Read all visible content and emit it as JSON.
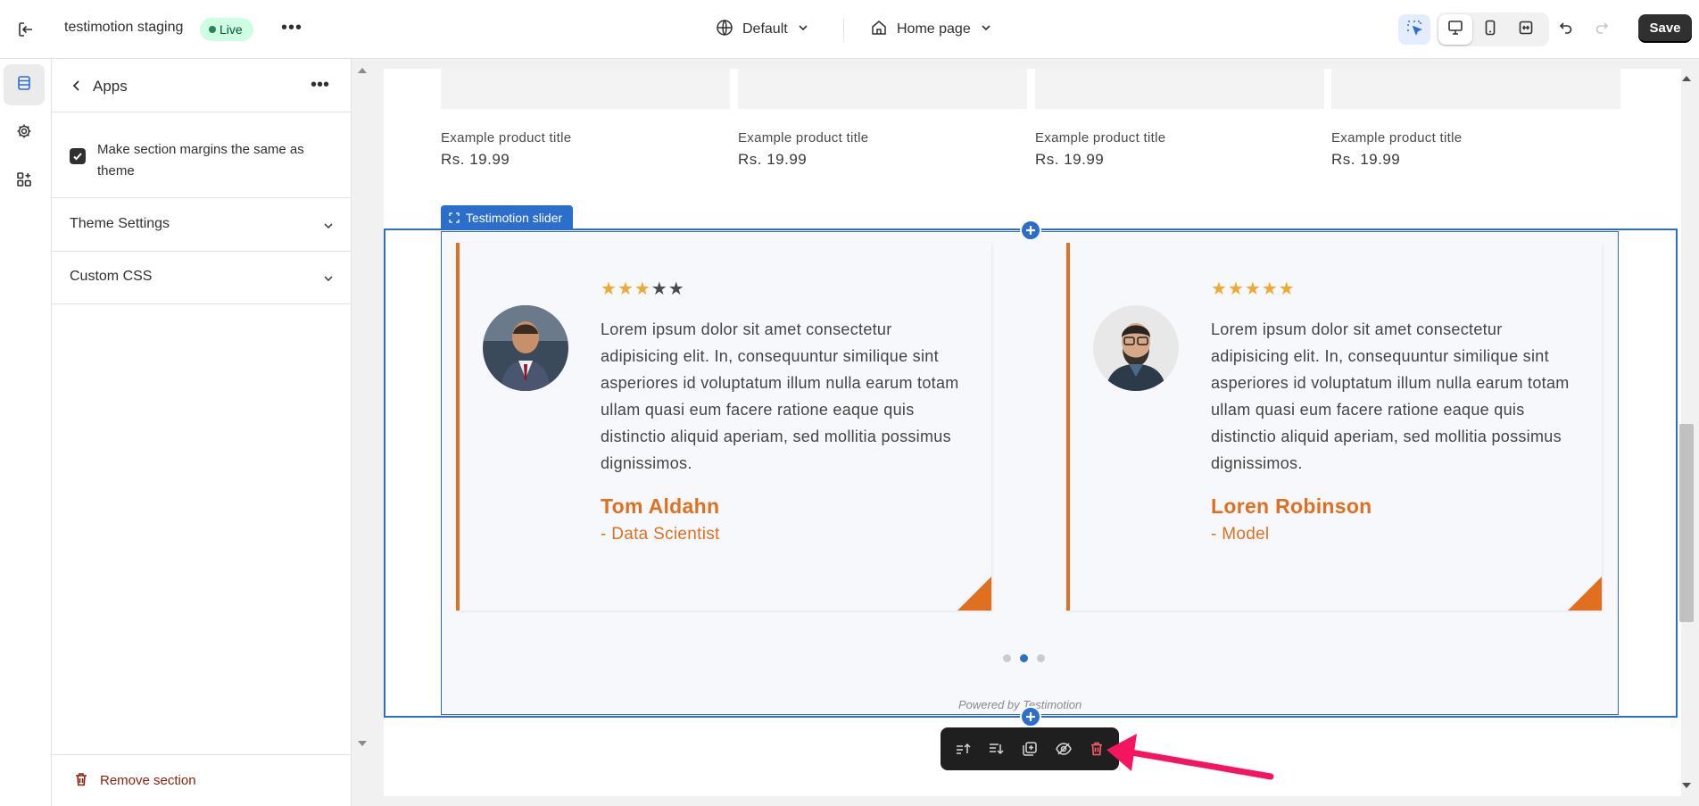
{
  "topbar": {
    "store_name": "testimotion staging",
    "status_badge": "Live",
    "theme_select": "Default",
    "page_select": "Home page",
    "save_label": "Save"
  },
  "sidebar": {
    "title": "Apps",
    "checkbox_label": "Make section margins the same as theme",
    "checkbox_checked": true,
    "accordions": [
      {
        "label": "Theme Settings"
      },
      {
        "label": "Custom CSS"
      }
    ],
    "remove_label": "Remove section"
  },
  "preview": {
    "products": [
      {
        "title": "Example product title",
        "price": "Rs. 19.99"
      },
      {
        "title": "Example product title",
        "price": "Rs. 19.99"
      },
      {
        "title": "Example product title",
        "price": "Rs. 19.99"
      },
      {
        "title": "Example product title",
        "price": "Rs. 19.99"
      }
    ],
    "section_tag": "Testimotion slider",
    "testimonials": [
      {
        "rating": 3,
        "quote": "Lorem ipsum dolor sit amet consectetur adipisicing elit. In, consequuntur similique sint asperiores id voluptatum illum nulla earum totam ullam quasi eum facere ratione eaque quis distinctio aliquid aperiam, sed mollitia possimus dignissimos.",
        "name": "Tom Aldahn",
        "role": "- Data Scientist"
      },
      {
        "rating": 5,
        "quote": "Lorem ipsum dolor sit amet consectetur adipisicing elit. In, consequuntur similique sint asperiores id voluptatum illum nulla earum totam ullam quasi eum facere ratione eaque quis distinctio aliquid aperiam, sed mollitia possimus dignissimos.",
        "name": "Loren Robinson",
        "role": "- Model"
      }
    ],
    "slider_pages": 3,
    "slider_active": 2,
    "powered_by": "Powered by Testimotion"
  },
  "colors": {
    "accent": "#e07020",
    "selection": "#2c6ecb",
    "danger": "#8e1f0b",
    "star_on": "#f0a830",
    "star_off": "#4a4a4a",
    "annotation_arrow": "#f5155f"
  }
}
